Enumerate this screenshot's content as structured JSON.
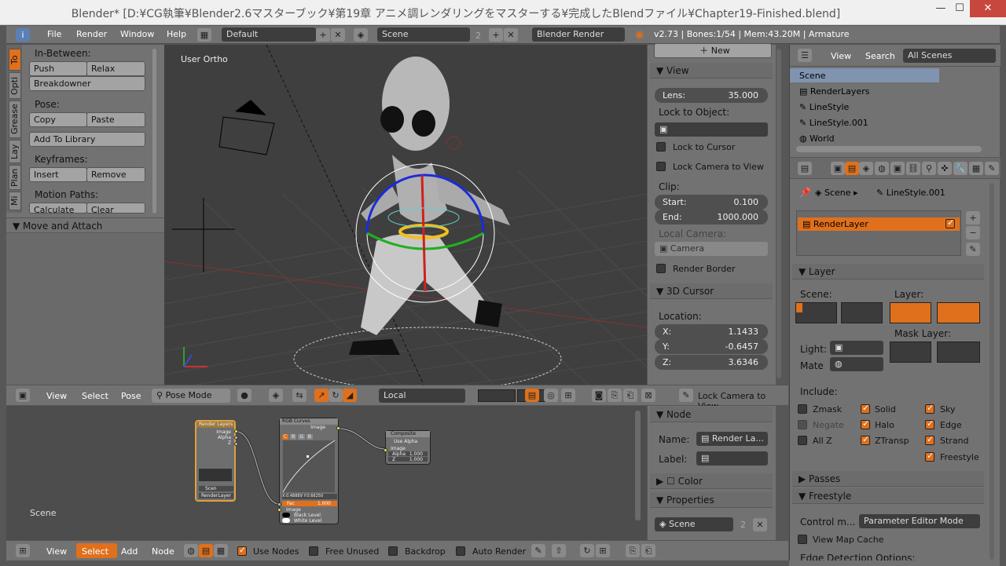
{
  "window": {
    "title": "Blender* [D:¥CG執筆¥Blender2.6マスターブック¥第19章 アニメ調レンダリングをマスターする¥完成したBlendファイル¥Chapter19-Finished.blend]",
    "minimize": "—",
    "maximize": "☐",
    "close": "✕"
  },
  "topbar": {
    "menus": [
      "File",
      "Render",
      "Window",
      "Help"
    ],
    "layout": "Default",
    "scene": "Scene",
    "scene_users": "2",
    "engine": "Blender Render",
    "stats": "v2.73 | Bones:1/54 | Mem:43.20M | Armature"
  },
  "tool_shelf": {
    "tabs": [
      "To",
      "Opti",
      "Grease",
      "Lay",
      "Plan",
      "Mi"
    ],
    "inbetween_label": "In-Between:",
    "push": "Push",
    "relax": "Relax",
    "breakdowner": "Breakdowner",
    "pose_label": "Pose:",
    "copy": "Copy",
    "paste": "Paste",
    "add_to_library": "Add To Library",
    "keyframes_label": "Keyframes:",
    "insert": "Insert",
    "remove": "Remove",
    "motion_paths_label": "Motion Paths:",
    "calculate": "Calculate",
    "clear": "Clear",
    "move_attach": "Move and Attach"
  },
  "viewport": {
    "label": "User Ortho"
  },
  "viewport_header": {
    "view": "View",
    "select": "Select",
    "pose": "Pose",
    "mode": "Pose Mode",
    "orientation": "Local",
    "lock_camera": "Lock Camera to View"
  },
  "properties_n": {
    "new": "New",
    "view_header": "View",
    "lens_label": "Lens:",
    "lens_value": "35.000",
    "lock_to_object": "Lock to Object:",
    "lock_to_cursor": "Lock to Cursor",
    "lock_camera_to_view": "Lock Camera to View",
    "clip_label": "Clip:",
    "start_label": "Start:",
    "start_value": "0.100",
    "end_label": "End:",
    "end_value": "1000.000",
    "local_camera": "Local Camera:",
    "camera": "Camera",
    "render_border": "Render Border",
    "cursor_header": "3D Cursor",
    "location_label": "Location:",
    "x_label": "X:",
    "x_value": "1.1433",
    "y_label": "Y:",
    "y_value": "-0.6457",
    "z_label": "Z:",
    "z_value": "3.6346"
  },
  "outliner": {
    "view": "View",
    "search": "Search",
    "filter": "All Scenes",
    "items": [
      "Scene",
      "RenderLayers",
      "LineStyle",
      "LineStyle.001",
      "World"
    ]
  },
  "properties": {
    "breadcrumb_scene": "Scene",
    "breadcrumb_linestyle": "LineStyle.001",
    "render_layer": "RenderLayer",
    "layer_header": "Layer",
    "scene_label": "Scene:",
    "layer_label": "Layer:",
    "mask_layer_label": "Mask Layer:",
    "light_label": "Light:",
    "mate_label": "Mate",
    "include_label": "Include:",
    "include": [
      {
        "label": "Zmask",
        "on": false
      },
      {
        "label": "Solid",
        "on": true
      },
      {
        "label": "Sky",
        "on": true
      },
      {
        "label": "Negate",
        "on": false
      },
      {
        "label": "Halo",
        "on": true
      },
      {
        "label": "Edge",
        "on": true
      },
      {
        "label": "All Z",
        "on": false
      },
      {
        "label": "ZTransp",
        "on": true
      },
      {
        "label": "Strand",
        "on": true
      },
      {
        "label": "Freestyle",
        "on": true
      }
    ],
    "passes_header": "Passes",
    "freestyle_header": "Freestyle",
    "control_mode_label": "Control m...",
    "control_mode_value": "Parameter Editor Mode",
    "view_map_cache": "View Map Cache",
    "edge_detection": "Edge Detection Options:"
  },
  "node_editor": {
    "scene_label": "Scene",
    "render_layers_node": {
      "title": "Render Layers",
      "outputs": [
        "Image",
        "Alpha",
        "Z"
      ],
      "scene": "Scen",
      "layer": "RenderLayer"
    },
    "rgb_curves_node": {
      "title": "RGB Curves",
      "output": "Image",
      "channels": [
        "C",
        "R",
        "G",
        "B"
      ],
      "x_readout": "X:0.48889",
      "y_readout": "Y:0.66250",
      "fac_label": "Fac",
      "fac_value": "1.000",
      "inputs": [
        "Image",
        "Black Level",
        "White Level"
      ]
    },
    "composite_node": {
      "title": "Composite",
      "use_alpha": "Use Alpha",
      "inputs": [
        "Image"
      ],
      "alpha_label": "Alpha",
      "alpha_value": "1.000",
      "z_label": "Z",
      "z_value": "1.000"
    }
  },
  "node_side": {
    "node_header": "Node",
    "name_label": "Name:",
    "name_value": "Render La...",
    "label_label": "Label:",
    "color_header": "Color",
    "properties_header": "Properties",
    "scene_value": "Scene",
    "scene_users": "2"
  },
  "node_header": {
    "view": "View",
    "select": "Select",
    "add": "Add",
    "node": "Node",
    "use_nodes": "Use Nodes",
    "free_unused": "Free Unused",
    "backdrop": "Backdrop",
    "auto_render": "Auto Render"
  }
}
